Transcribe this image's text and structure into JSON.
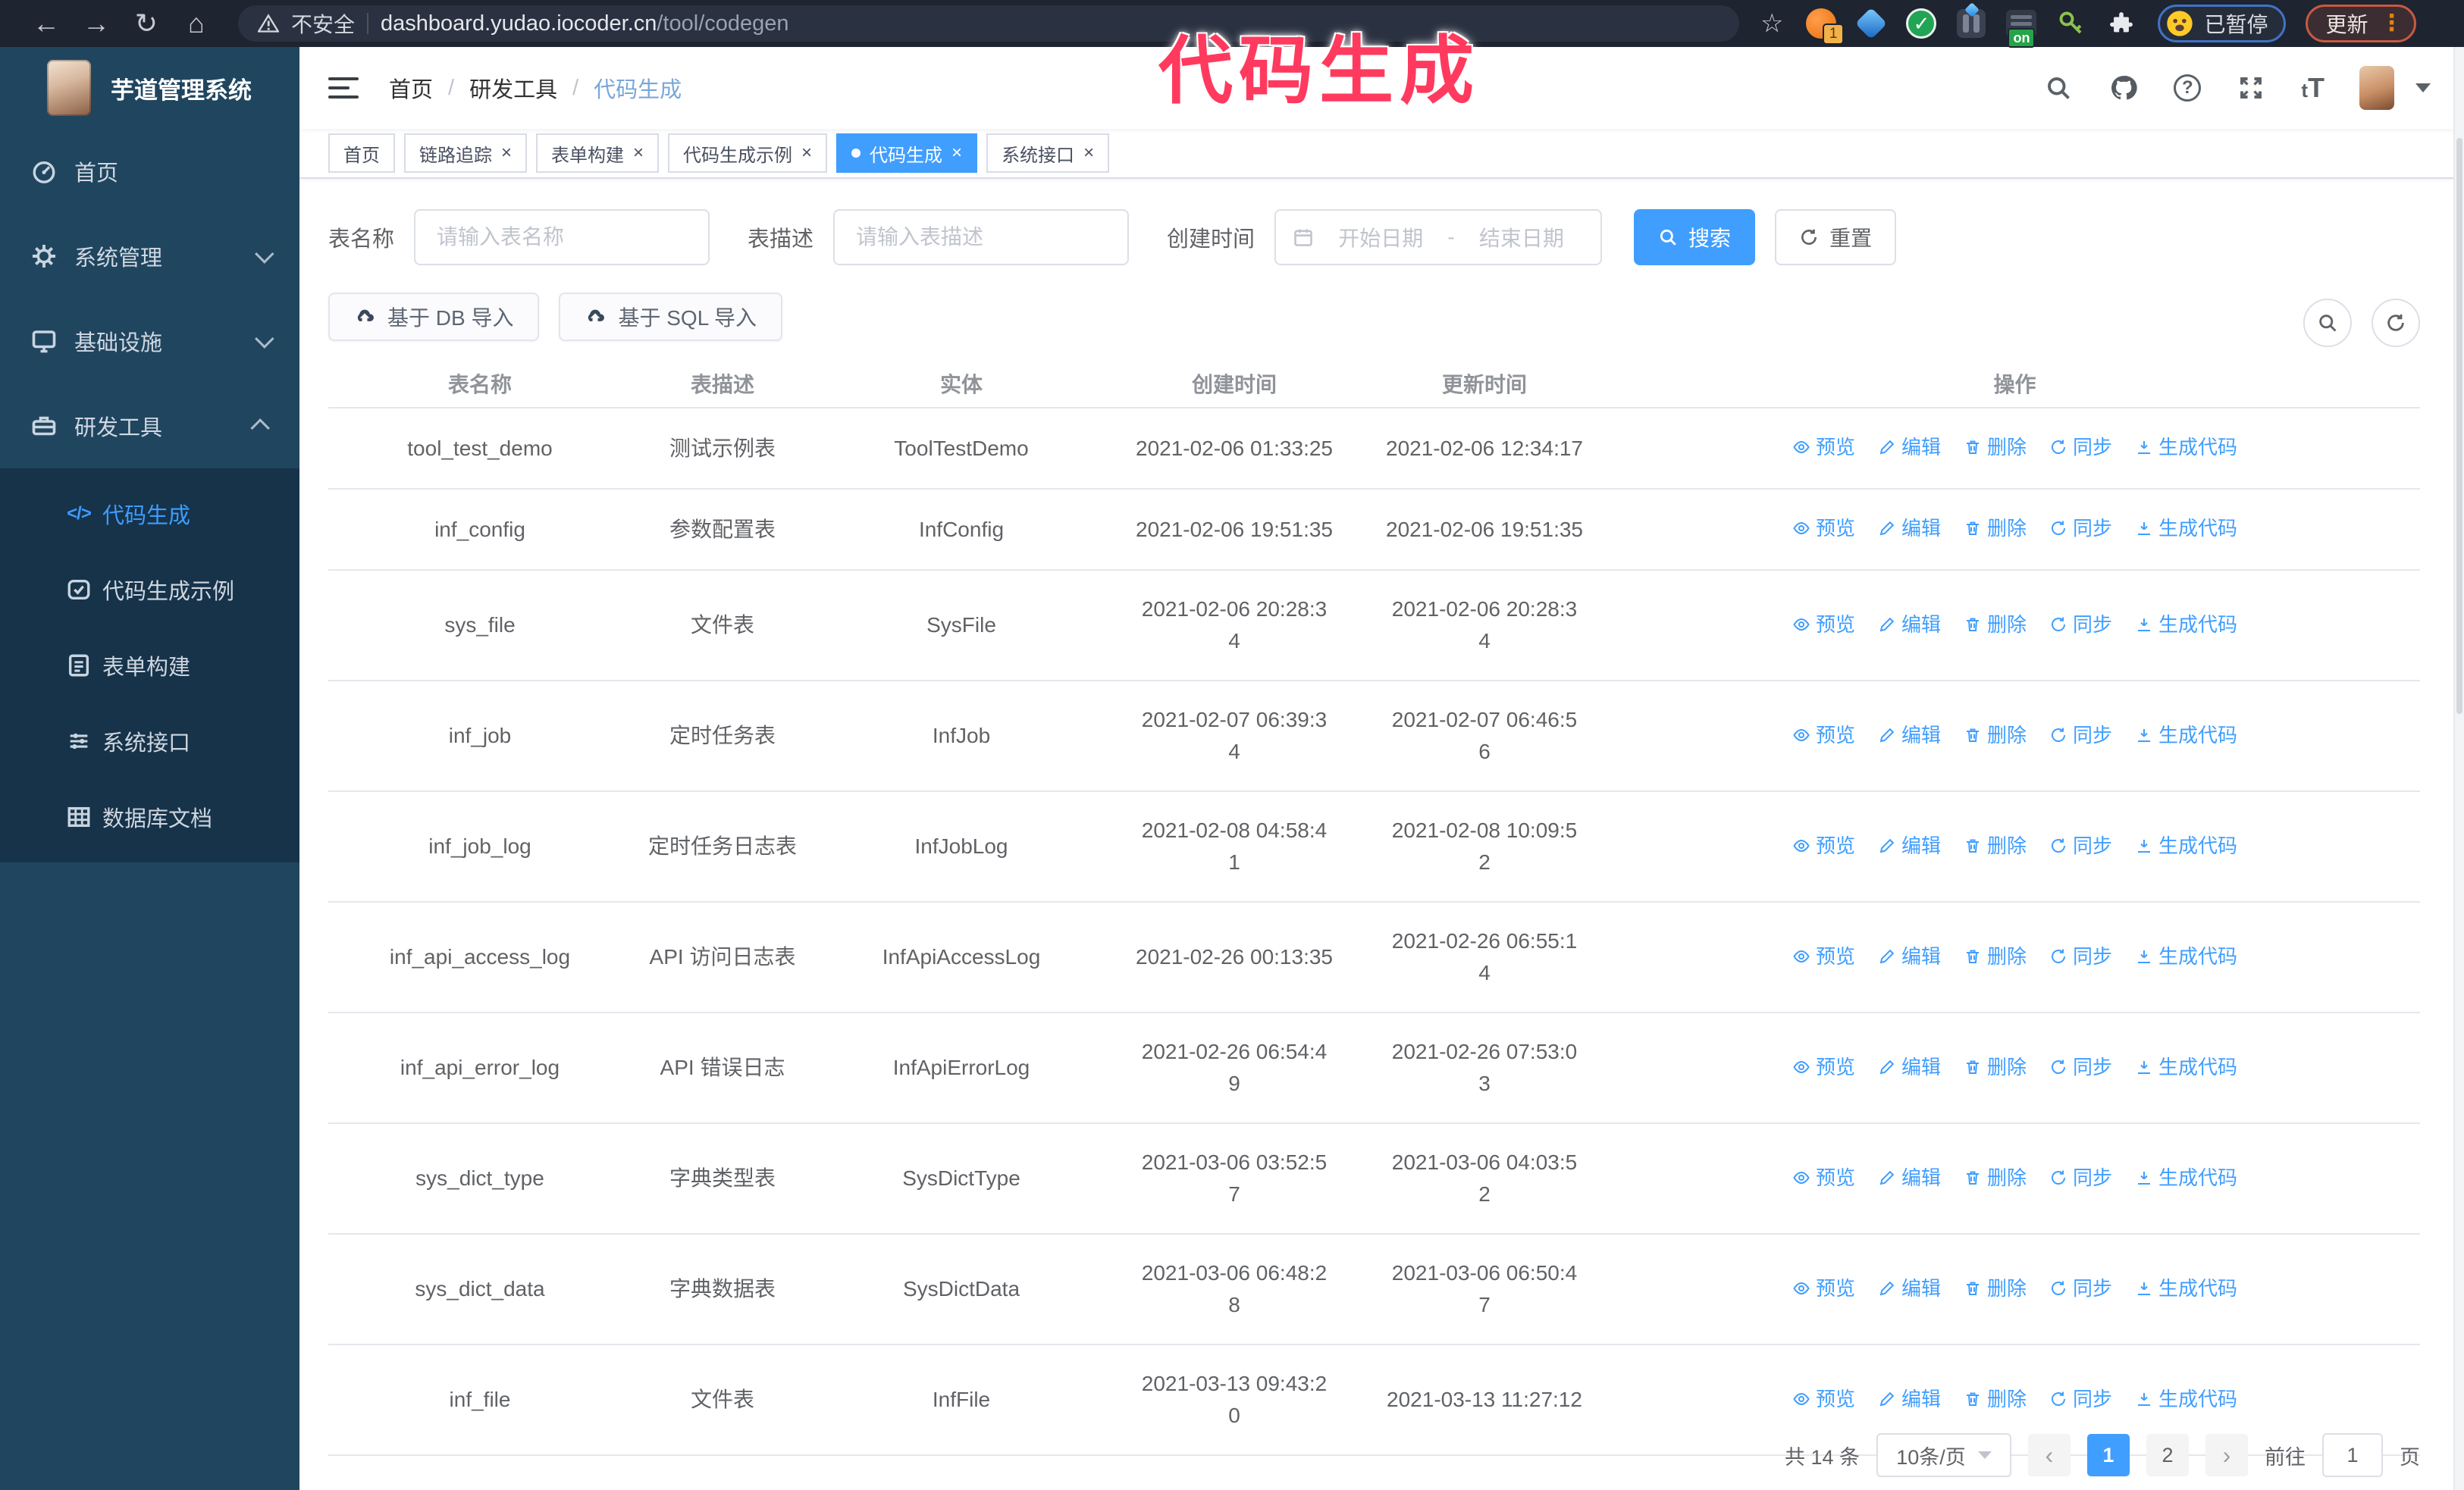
{
  "browser": {
    "security_label": "不安全",
    "url_host": "dashboard.yudao.iocoder.cn",
    "url_path": "/tool/codegen",
    "extension_badge": "1",
    "extension_on_badge": "on",
    "paused_badge": "已暂停",
    "update_button": "更新"
  },
  "watermark": "代码生成",
  "app": {
    "title": "芋道管理系统",
    "breadcrumb": [
      "首页",
      "研发工具",
      "代码生成"
    ],
    "text_size_icon": "tT"
  },
  "sidebar": {
    "items": [
      {
        "label": "首页"
      },
      {
        "label": "系统管理"
      },
      {
        "label": "基础设施"
      },
      {
        "label": "研发工具"
      }
    ],
    "submenu": [
      {
        "label": "代码生成",
        "active": true
      },
      {
        "label": "代码生成示例",
        "active": false
      },
      {
        "label": "表单构建",
        "active": false
      },
      {
        "label": "系统接口",
        "active": false
      },
      {
        "label": "数据库文档",
        "active": false
      }
    ]
  },
  "tabs": [
    {
      "label": "首页",
      "closable": false,
      "active": false
    },
    {
      "label": "链路追踪",
      "closable": true,
      "active": false
    },
    {
      "label": "表单构建",
      "closable": true,
      "active": false
    },
    {
      "label": "代码生成示例",
      "closable": true,
      "active": false
    },
    {
      "label": "代码生成",
      "closable": true,
      "active": true
    },
    {
      "label": "系统接口",
      "closable": true,
      "active": false
    }
  ],
  "filters": {
    "name_label": "表名称",
    "name_placeholder": "请输入表名称",
    "desc_label": "表描述",
    "desc_placeholder": "请输入表描述",
    "time_label": "创建时间",
    "start_placeholder": "开始日期",
    "range_separator": "-",
    "end_placeholder": "结束日期",
    "search_label": "搜索",
    "reset_label": "重置"
  },
  "toolbar": {
    "import_db_label": "基于 DB 导入",
    "import_sql_label": "基于 SQL 导入"
  },
  "table": {
    "headers": [
      "表名称",
      "表描述",
      "实体",
      "创建时间",
      "更新时间",
      "操作"
    ],
    "row_actions": [
      "预览",
      "编辑",
      "删除",
      "同步",
      "生成代码"
    ],
    "rows": [
      {
        "name": "tool_test_demo",
        "desc": "测试示例表",
        "entity": "ToolTestDemo",
        "created": "2021-02-06 01:33:25",
        "updated": "2021-02-06 12:34:17"
      },
      {
        "name": "inf_config",
        "desc": "参数配置表",
        "entity": "InfConfig",
        "created": "2021-02-06 19:51:35",
        "updated": "2021-02-06 19:51:35"
      },
      {
        "name": "sys_file",
        "desc": "文件表",
        "entity": "SysFile",
        "created": "2021-02-06 20:28:34",
        "updated": "2021-02-06 20:28:34"
      },
      {
        "name": "inf_job",
        "desc": "定时任务表",
        "entity": "InfJob",
        "created": "2021-02-07 06:39:34",
        "updated": "2021-02-07 06:46:56"
      },
      {
        "name": "inf_job_log",
        "desc": "定时任务日志表",
        "entity": "InfJobLog",
        "created": "2021-02-08 04:58:41",
        "updated": "2021-02-08 10:09:52"
      },
      {
        "name": "inf_api_access_log",
        "desc": "API 访问日志表",
        "entity": "InfApiAccessLog",
        "created": "2021-02-26 00:13:35",
        "updated": "2021-02-26 06:55:14"
      },
      {
        "name": "inf_api_error_log",
        "desc": "API 错误日志",
        "entity": "InfApiErrorLog",
        "created": "2021-02-26 06:54:49",
        "updated": "2021-02-26 07:53:03"
      },
      {
        "name": "sys_dict_type",
        "desc": "字典类型表",
        "entity": "SysDictType",
        "created": "2021-03-06 03:52:57",
        "updated": "2021-03-06 04:03:52"
      },
      {
        "name": "sys_dict_data",
        "desc": "字典数据表",
        "entity": "SysDictData",
        "created": "2021-03-06 06:48:28",
        "updated": "2021-03-06 06:50:47"
      },
      {
        "name": "inf_file",
        "desc": "文件表",
        "entity": "InfFile",
        "created": "2021-03-13 09:43:20",
        "updated": "2021-03-13 11:27:12"
      }
    ]
  },
  "pagination": {
    "total": "共 14 条",
    "page_size": "10条/页",
    "prev": "‹",
    "pages": [
      "1",
      "2"
    ],
    "active_page": "1",
    "next": "›",
    "goto_label": "前往",
    "goto_value": "1",
    "page_suffix": "页"
  },
  "colors": {
    "accent": "#409eff",
    "sidebar_bg": "#20455f",
    "submenu_bg": "#16334a",
    "watermark": "#ff3a5e",
    "toolbar_bg": "#1e2430"
  }
}
